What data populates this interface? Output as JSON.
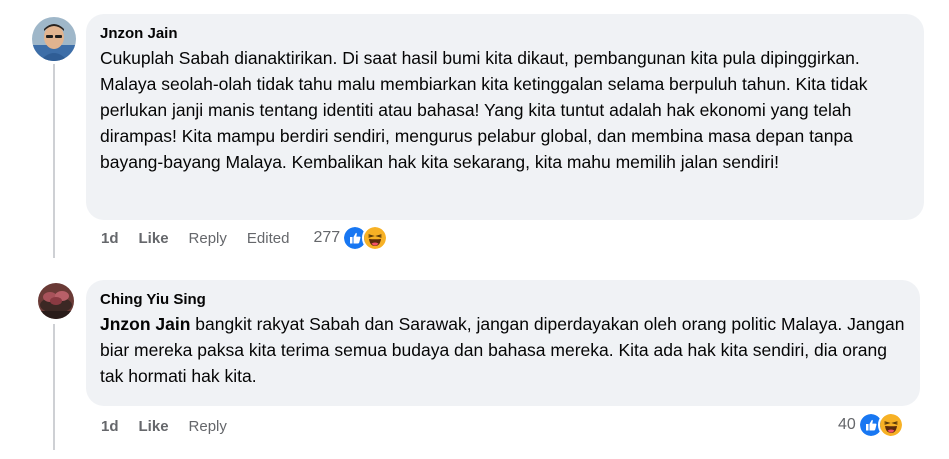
{
  "comments": [
    {
      "author": "Jnzon Jain",
      "text": "Cukuplah Sabah dianaktirikan. Di saat hasil bumi kita dikaut, pembangunan kita pula dipinggirkan. Malaya seolah-olah tidak tahu malu membiarkan kita ketinggalan selama berpuluh tahun. Kita tidak perlukan janji manis tentang identiti atau bahasa! Yang kita tuntut adalah hak ekonomi yang telah dirampas! Kita mampu berdiri sendiri, mengurus pelabur global, dan membina masa depan tanpa bayang-bayang Malaya. Kembalikan hak kita sekarang, kita mahu memilih jalan sendiri!",
      "time": "1d",
      "like_label": "Like",
      "reply_label": "Reply",
      "edited_label": "Edited",
      "reaction_count": "277",
      "reactions": [
        "like-icon",
        "haha-icon"
      ]
    },
    {
      "author": "Ching Yiu Sing",
      "mention": "Jnzon Jain",
      "text": " bangkit rakyat Sabah dan Sarawak, jangan diperdayakan oleh orang politic Malaya. Jangan biar mereka paksa kita terima semua budaya dan bahasa mereka. Kita ada hak kita sendiri, dia orang tak hormati hak kita.",
      "time": "1d",
      "like_label": "Like",
      "reply_label": "Reply",
      "reaction_count": "40",
      "reactions": [
        "like-icon",
        "haha-icon"
      ]
    }
  ],
  "colors": {
    "bubble": "#f0f2f5",
    "meta": "#65676b",
    "text": "#050505",
    "like_blue": "#1877f2",
    "haha_yellow": "#f7b125"
  }
}
